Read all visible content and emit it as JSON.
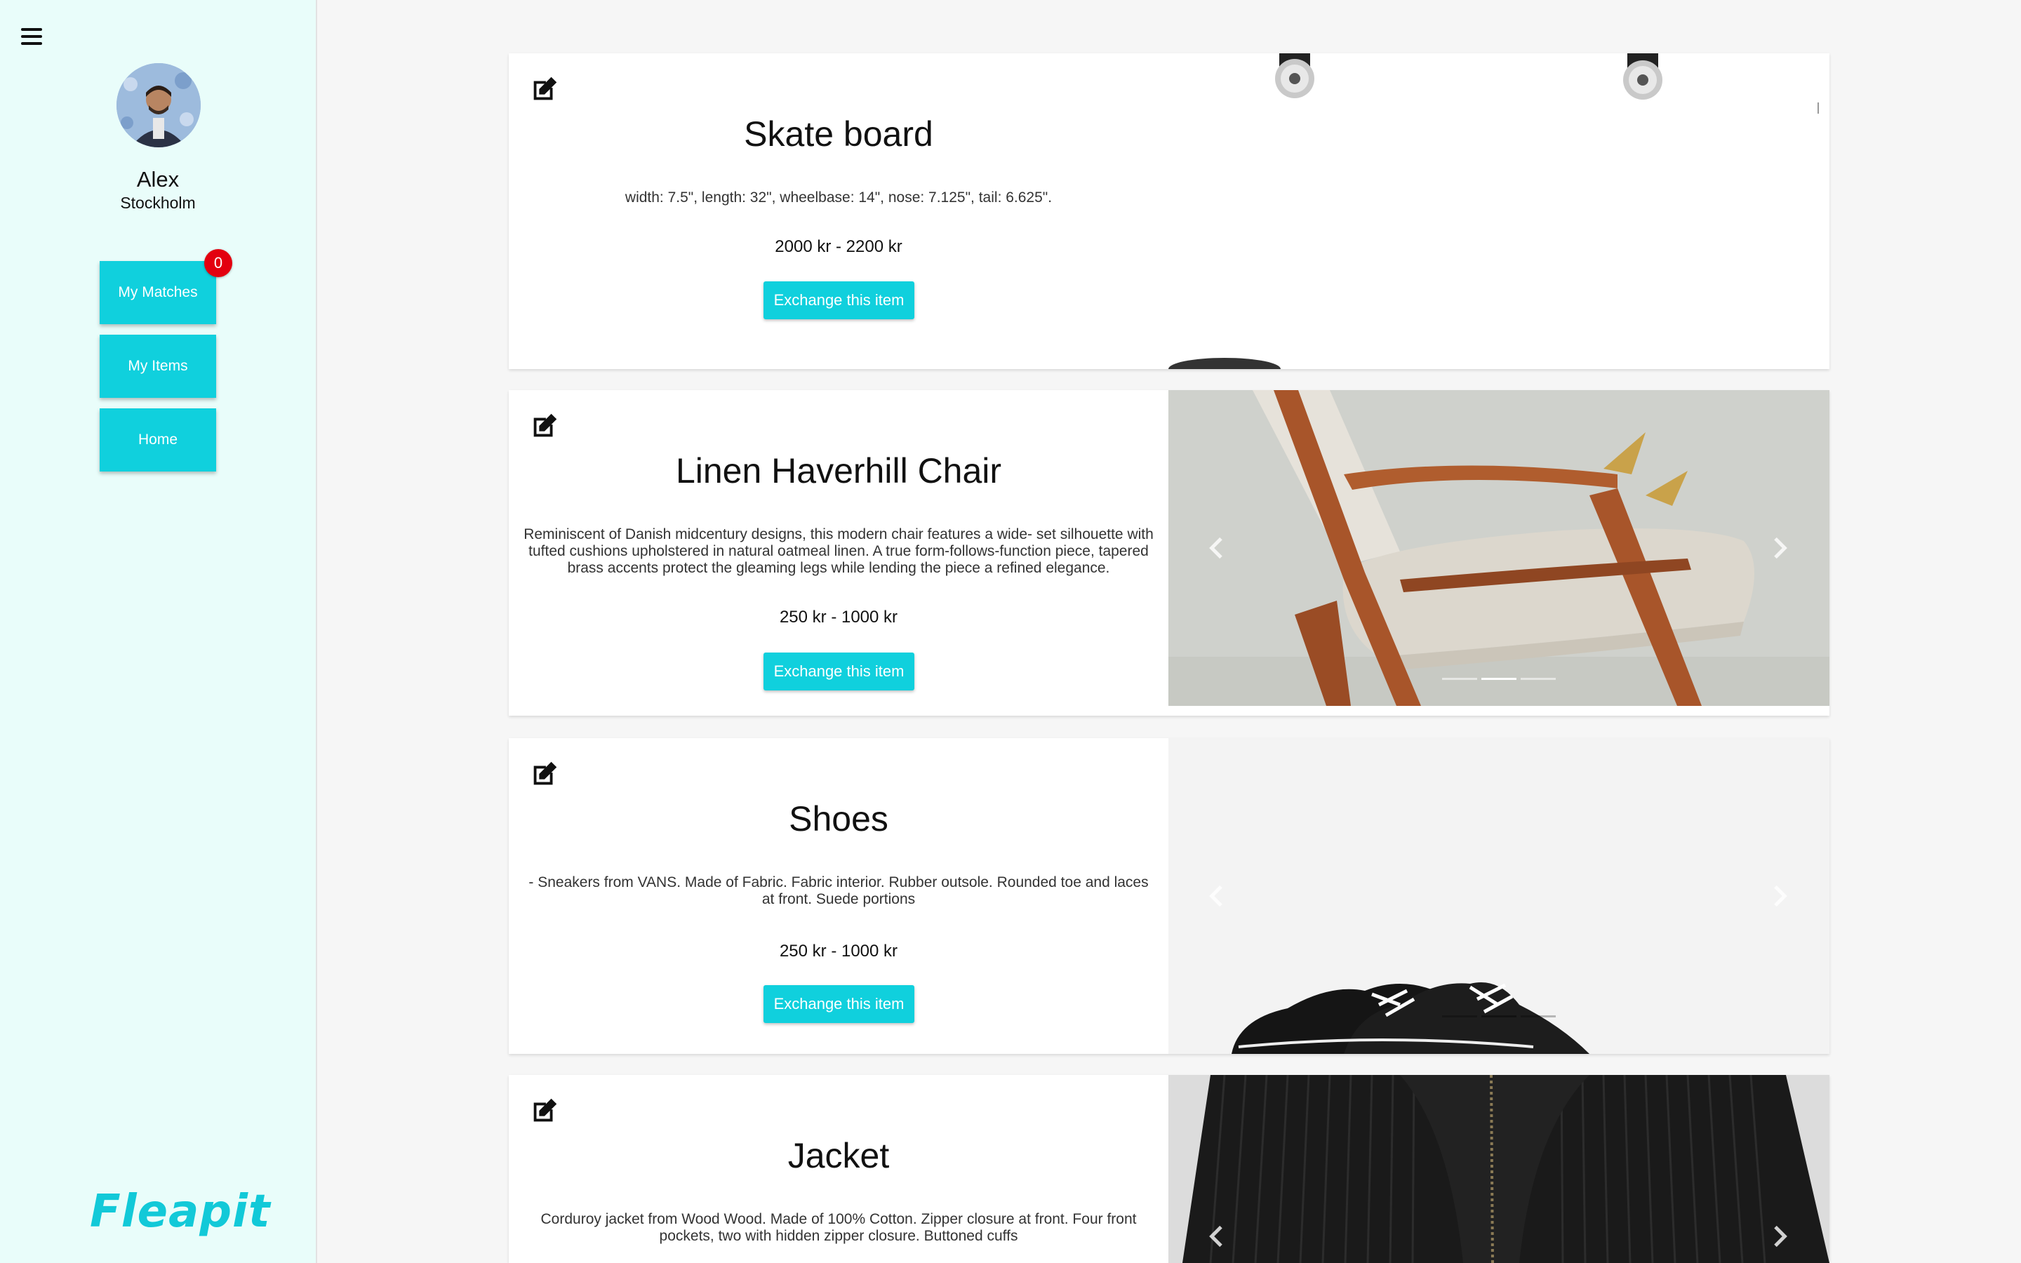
{
  "sidebar": {
    "user": {
      "name": "Alex",
      "city": "Stockholm"
    },
    "nav": [
      {
        "label": "My Matches",
        "badge": "0"
      },
      {
        "label": "My Items"
      },
      {
        "label": "Home"
      }
    ],
    "logo": "Fleapit"
  },
  "items": [
    {
      "title": "Skate board",
      "description": "width: 7.5\", length: 32\", wheelbase: 14\", nose: 7.125\", tail: 6.625\".",
      "price": "2000 kr - 2200 kr",
      "button": "Exchange this item",
      "image": "skateboard"
    },
    {
      "title": "Linen Haverhill Chair",
      "description": "Reminiscent of Danish midcentury designs, this modern chair features a wide- set silhouette with tufted cushions upholstered in natural oatmeal linen. A true form-follows-function piece, tapered brass accents protect the gleaming legs while lending the piece a refined elegance.",
      "price": "250 kr - 1000 kr",
      "button": "Exchange this item",
      "image": "chair"
    },
    {
      "title": "Shoes",
      "description": "- Sneakers from VANS. Made of Fabric. Fabric interior. Rubber outsole. Rounded toe and laces at front. Suede portions",
      "price": "250 kr - 1000 kr",
      "button": "Exchange this item",
      "image": "shoes"
    },
    {
      "title": "Jacket",
      "description": "Corduroy jacket from Wood Wood. Made of 100% Cotton. Zipper closure at front. Four front pockets, two with hidden zipper closure. Buttoned cuffs",
      "price": "",
      "button": "",
      "image": "jacket"
    }
  ],
  "colors": {
    "accent": "#10d0dd",
    "sidebar_bg": "#e9fdfa",
    "badge": "#e3000f",
    "page_bg": "#f6f6f6"
  },
  "icons": [
    "hamburger-icon",
    "edit-icon",
    "chevron-left-icon",
    "chevron-right-icon"
  ]
}
